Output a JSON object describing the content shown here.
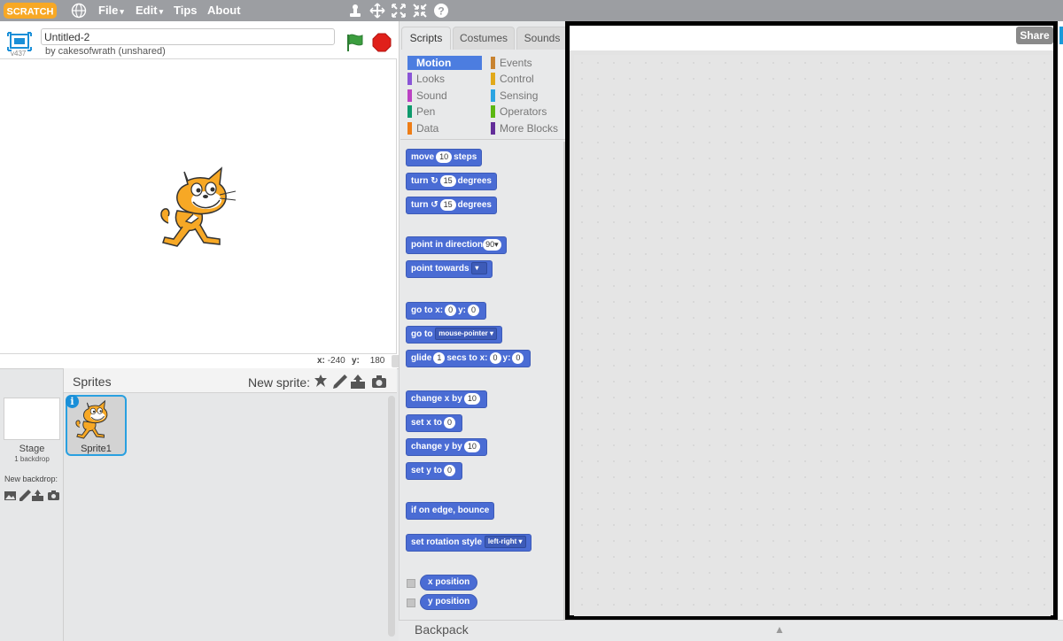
{
  "menubar": {
    "logo_text": "SCRATCH",
    "menus": [
      {
        "label": "File",
        "caret": "▾"
      },
      {
        "label": "Edit",
        "caret": "▾"
      },
      {
        "label": "Tips"
      },
      {
        "label": "About"
      }
    ],
    "tool_icons": [
      "duplicate-stamp-icon",
      "cut-scissors-icon",
      "grow-icon",
      "shrink-icon",
      "help-icon"
    ],
    "bar_color": "#9c9ea2"
  },
  "project": {
    "version": "v437",
    "title": "Untitled-2",
    "byline": "by cakesofwrath (unshared)"
  },
  "stage": {
    "x_label": "x:",
    "x_value": "-240",
    "y_label": "y:",
    "y_value": "180"
  },
  "sprites": {
    "header": "Sprites",
    "new_sprite": "New sprite:",
    "new_sprite_icons": [
      "sprite-library-icon",
      "paint-brush-icon",
      "upload-icon",
      "camera-icon"
    ],
    "stage_name": "Stage",
    "stage_backdrops": "1 backdrop",
    "new_backdrop": "New backdrop:",
    "new_backdrop_icons": [
      "backdrop-library-icon",
      "paint-brush-icon",
      "upload-icon",
      "camera-icon"
    ],
    "items": [
      {
        "name": "Sprite1",
        "selected": true
      }
    ],
    "selected_color": "#29a0e0"
  },
  "tabs": [
    {
      "label": "Scripts",
      "active": true
    },
    {
      "label": "Costumes",
      "active": false
    },
    {
      "label": "Sounds",
      "active": false
    }
  ],
  "categories": [
    {
      "label": "Motion",
      "color": "#4a6cd4",
      "active": true
    },
    {
      "label": "Looks",
      "color": "#8a55d7"
    },
    {
      "label": "Sound",
      "color": "#bb42c3"
    },
    {
      "label": "Pen",
      "color": "#0e9a6c"
    },
    {
      "label": "Data",
      "color": "#ee7d16"
    },
    {
      "label": "Events",
      "color": "#c88330"
    },
    {
      "label": "Control",
      "color": "#e1a91a"
    },
    {
      "label": "Sensing",
      "color": "#2ca5e2"
    },
    {
      "label": "Operators",
      "color": "#5cb712"
    },
    {
      "label": "More Blocks",
      "color": "#632d99"
    }
  ],
  "blocks": {
    "move": {
      "pre": "move",
      "val": "10",
      "post": "steps"
    },
    "turn_cw": {
      "pre": "turn",
      "val": "15",
      "post": "degrees"
    },
    "turn_ccw": {
      "pre": "turn",
      "val": "15",
      "post": "degrees"
    },
    "point_dir": {
      "pre": "point in direction",
      "val": "90▾"
    },
    "point_towards": {
      "pre": "point towards",
      "val": "▾"
    },
    "go_to_xy": {
      "pre": "go to x:",
      "x": "0",
      "mid": "y:",
      "y": "0"
    },
    "go_to": {
      "pre": "go to",
      "val": "mouse-pointer ▾"
    },
    "glide": {
      "pre": "glide",
      "secs": "1",
      "mid1": "secs to x:",
      "x": "0",
      "mid2": "y:",
      "y": "0"
    },
    "change_x": {
      "pre": "change x by",
      "val": "10"
    },
    "set_x": {
      "pre": "set x to",
      "val": "0"
    },
    "change_y": {
      "pre": "change y by",
      "val": "10"
    },
    "set_y": {
      "pre": "set y to",
      "val": "0"
    },
    "bounce": {
      "pre": "if on edge, bounce"
    },
    "rotation_style": {
      "pre": "set rotation style",
      "val": "left-right ▾"
    },
    "x_position": {
      "pre": "x position"
    },
    "y_position": {
      "pre": "y position"
    }
  },
  "canvas": {
    "share": "Share"
  },
  "backpack": {
    "label": "Backpack",
    "arrow": "▲"
  }
}
